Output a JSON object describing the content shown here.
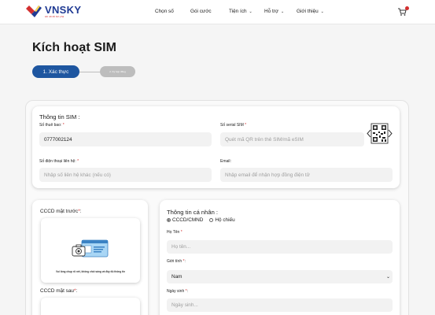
{
  "header": {
    "brand": "VNSKY",
    "tagline": "kết nối để bứt phá",
    "nav": [
      "Chọn số",
      "Gói cước",
      "Tiện ích",
      "Hỗ trợ",
      "Giới thiệu"
    ],
    "cart_badge_color": "#d32f2f"
  },
  "page": {
    "title": "Kích hoạt SIM",
    "steps": [
      "1. Xác thực",
      "2. Ký hợp đồng"
    ]
  },
  "sim_info": {
    "title": "Thông tin SIM :",
    "subscriber_label": "Số thuê bao:",
    "subscriber_value": "0777002124",
    "serial_label": "Số serial SIM",
    "serial_placeholder": "Quét mã QR trên thẻ SIM/mã eSIM",
    "contact_label": "Số điện thoại liên hệ:",
    "contact_placeholder": "Nhập số liên hệ khác (nếu có)",
    "email_label": "Email:",
    "email_placeholder": "Nhập email để nhận hợp đồng điện tử"
  },
  "cccd": {
    "front_label": "CCCD mặt trước",
    "upload_hint": "Vui lòng chụp rõ nét, không chói sáng và đầy đủ thông tin",
    "back_label": "CCCD mặt sau"
  },
  "personal": {
    "title": "Thông tin cá nhân :",
    "doc_options": [
      "CCCD/CMND",
      "Hộ chiếu"
    ],
    "selected_doc": "CCCD/CMND",
    "name_label": "Họ Tên",
    "name_placeholder": "Họ tên...",
    "gender_label": "Giới tính",
    "gender_value": "Nam",
    "dob_label": "Ngày sinh",
    "dob_placeholder": "Ngày sinh..."
  },
  "colors": {
    "primary": "#1e56a0",
    "required": "#d32f2f",
    "brand_blue": "#1f3a93"
  }
}
